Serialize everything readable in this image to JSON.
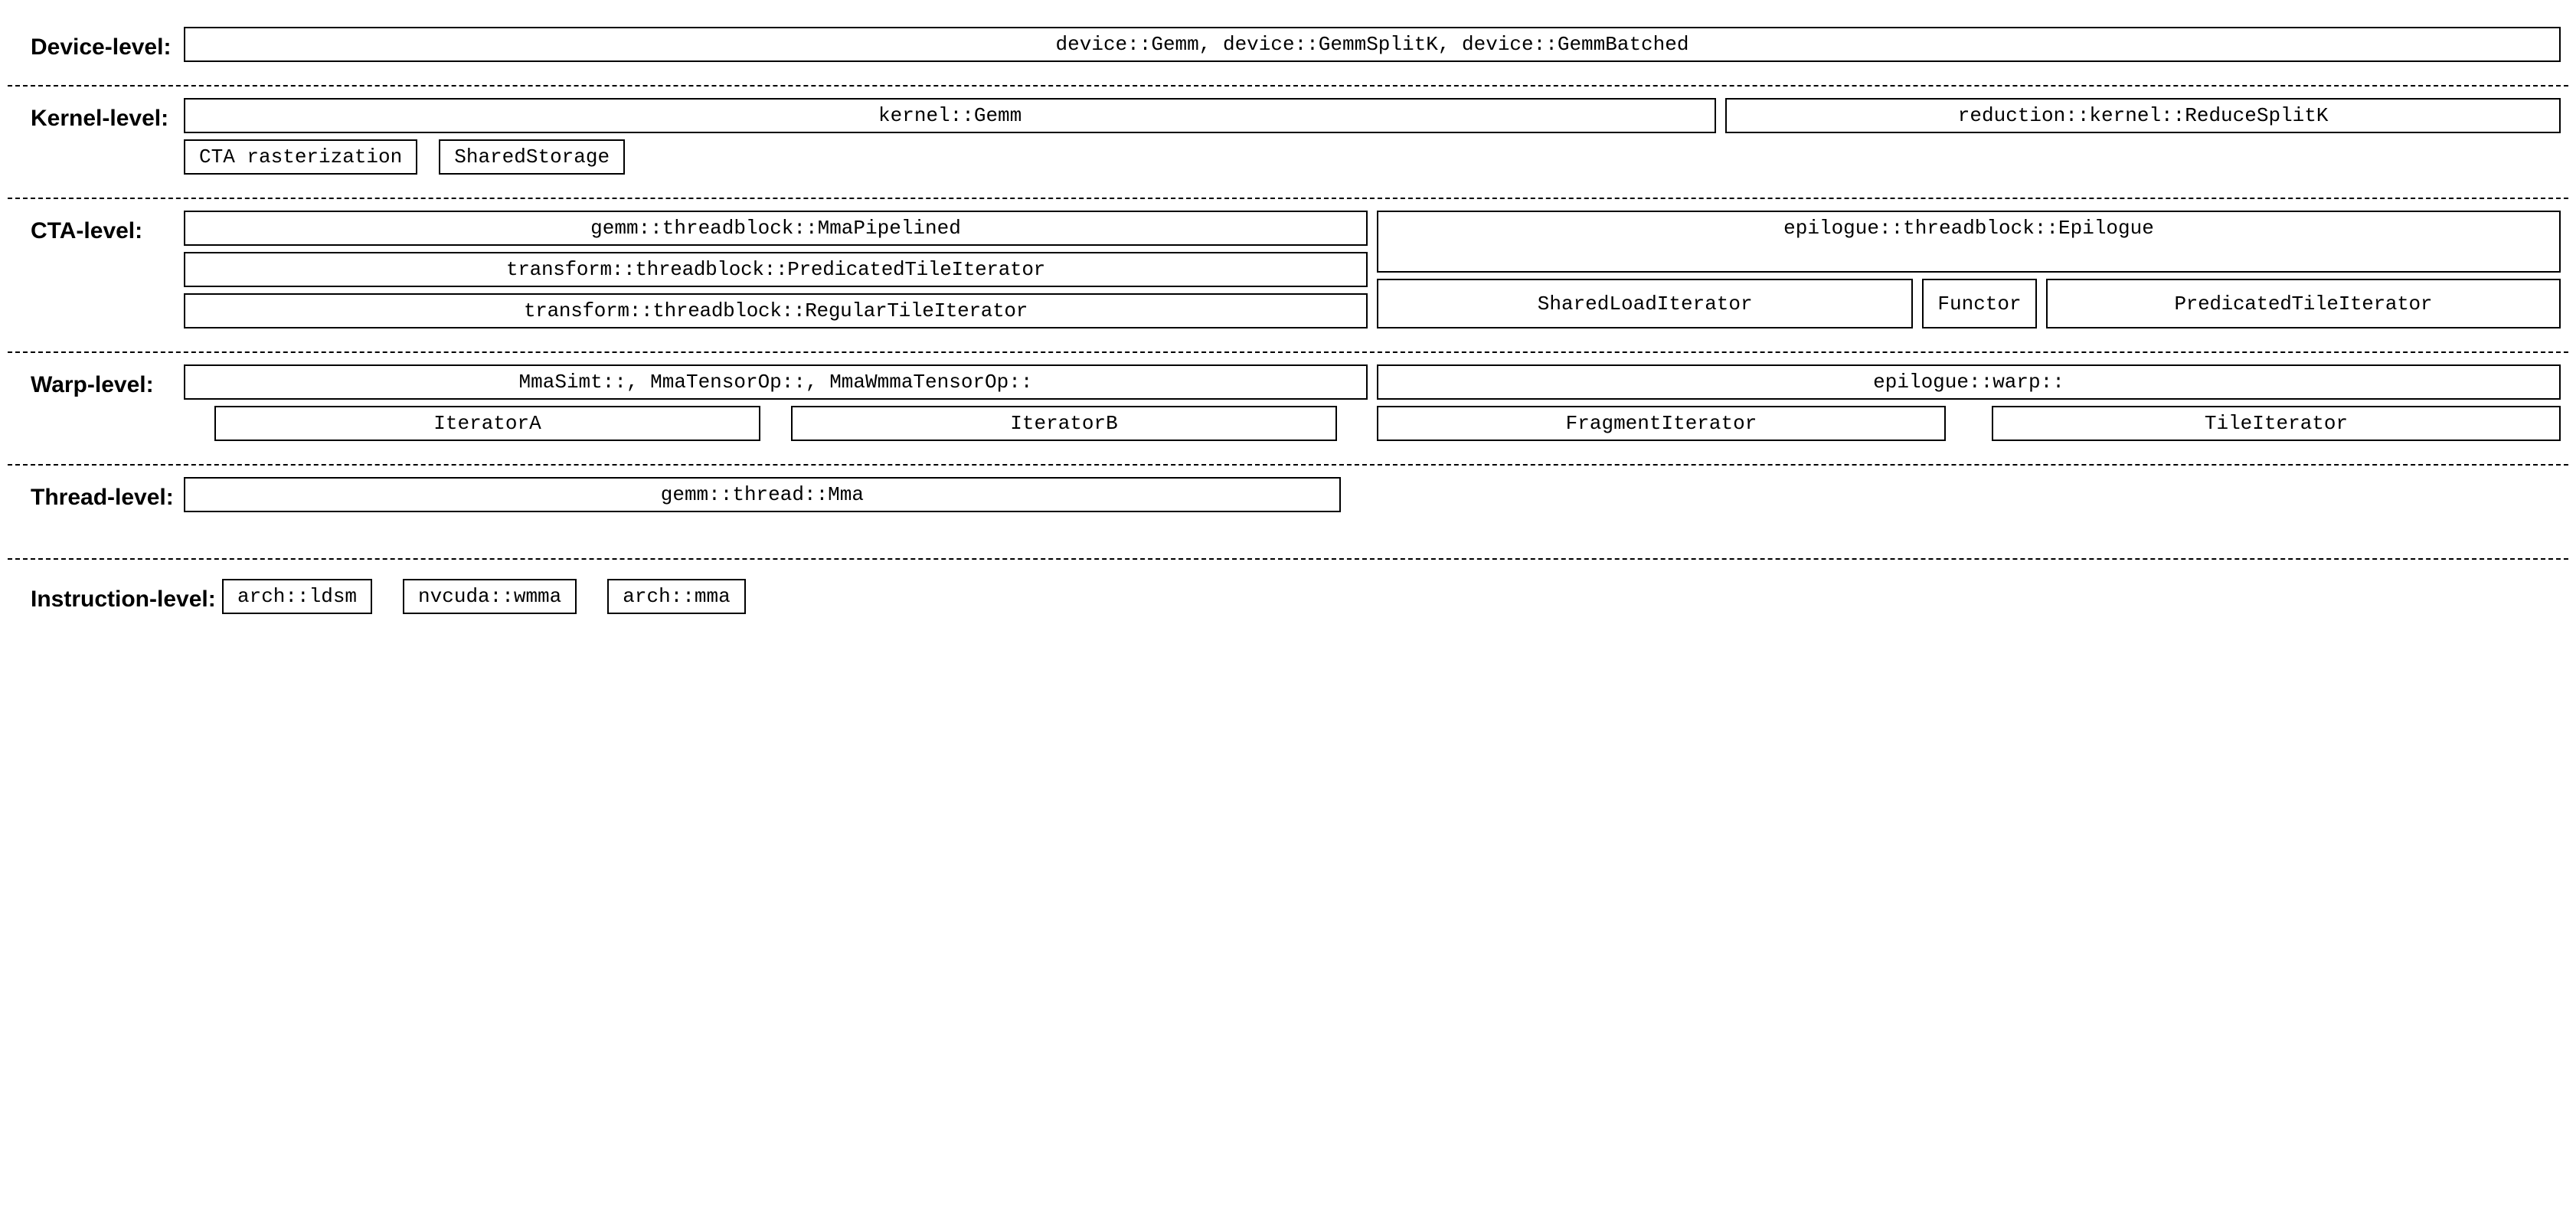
{
  "labels": {
    "device": "Device-level:",
    "kernel": "Kernel-level:",
    "cta": "CTA-level:",
    "warp": "Warp-level:",
    "thread": "Thread-level:",
    "instruction": "Instruction-level:"
  },
  "device": {
    "main": "device::Gemm, device::GemmSplitK, device::GemmBatched"
  },
  "kernel": {
    "gemm": "kernel::Gemm",
    "reduce": "reduction::kernel::ReduceSplitK",
    "cta_raster": "CTA rasterization",
    "shared_storage": "SharedStorage"
  },
  "cta": {
    "mma_pipelined": "gemm::threadblock::MmaPipelined",
    "predicated_iter": "transform::threadblock::PredicatedTileIterator",
    "regular_iter": "transform::threadblock::RegularTileIterator",
    "epilogue": "epilogue::threadblock::Epilogue",
    "shared_load": "SharedLoadIterator",
    "functor": "Functor",
    "pred_tile": "PredicatedTileIterator"
  },
  "warp": {
    "mma_ops": "MmaSimt::, MmaTensorOp::, MmaWmmaTensorOp::",
    "iter_a": "IteratorA",
    "iter_b": "IteratorB",
    "epilogue_warp": "epilogue::warp::",
    "fragment_iter": "FragmentIterator",
    "tile_iter": "TileIterator"
  },
  "thread": {
    "mma": "gemm::thread::Mma"
  },
  "instruction": {
    "ldsm": "arch::ldsm",
    "wmma": "nvcuda::wmma",
    "mma": "arch::mma"
  }
}
